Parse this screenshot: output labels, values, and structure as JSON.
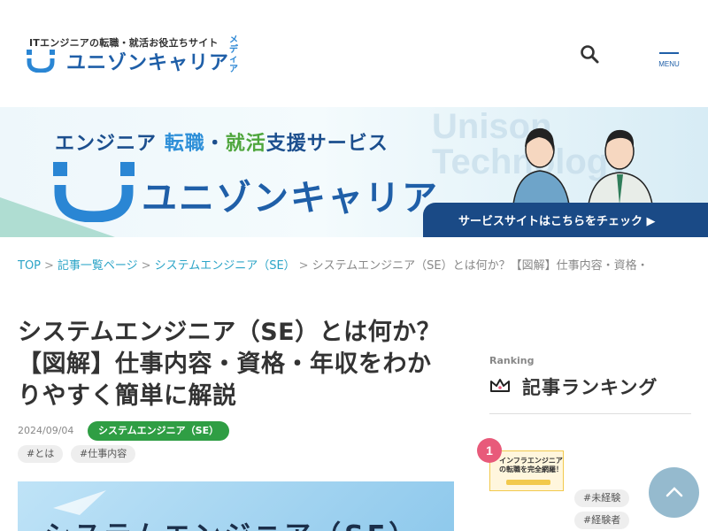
{
  "header": {
    "tagline": "ITエンジニアの転職・就活お役立ちサイト",
    "logo_name": "ユニゾンキャリア",
    "logo_media": "メディア",
    "menu_label": "MENU",
    "brand_color": "#1f5fa8"
  },
  "banner": {
    "tagline_prefix": "エンジニア",
    "tagline_hl1": "転職",
    "tagline_dot": "・",
    "tagline_hl2": "就活",
    "tagline_suffix": "支援サービス",
    "watermark_line1": "Unison",
    "watermark_line2": "Technology",
    "name": "ユニゾンキャリア",
    "cta": "サービスサイトはこちらをチェック ▶"
  },
  "breadcrumb": {
    "items": [
      "TOP",
      "記事一覧ページ",
      "システムエンジニア（SE）"
    ],
    "current": "システムエンジニア（SE）とは何か？【図解】仕事内容・資格・",
    "separator": ">"
  },
  "article": {
    "title": "システムエンジニア（SE）とは何か？【図解】仕事内容・資格・年収をわかりやすく簡単に解説",
    "date": "2024/09/04",
    "category": "システムエンジニア（SE）",
    "tags": [
      "#とは",
      "#仕事内容"
    ],
    "hero_text": "システムエンジニア（SE）"
  },
  "ranking": {
    "label": "Ranking",
    "title": "記事ランキング",
    "first": {
      "rank": "1",
      "thumb_text": "インフラエンジニアの転職を完全網羅！",
      "tags": [
        "#未経験",
        "#経験者"
      ]
    }
  },
  "colors": {
    "link": "#2ba4c7",
    "category_bg": "#2f9e44",
    "rank_badge": "#e85a7a"
  }
}
